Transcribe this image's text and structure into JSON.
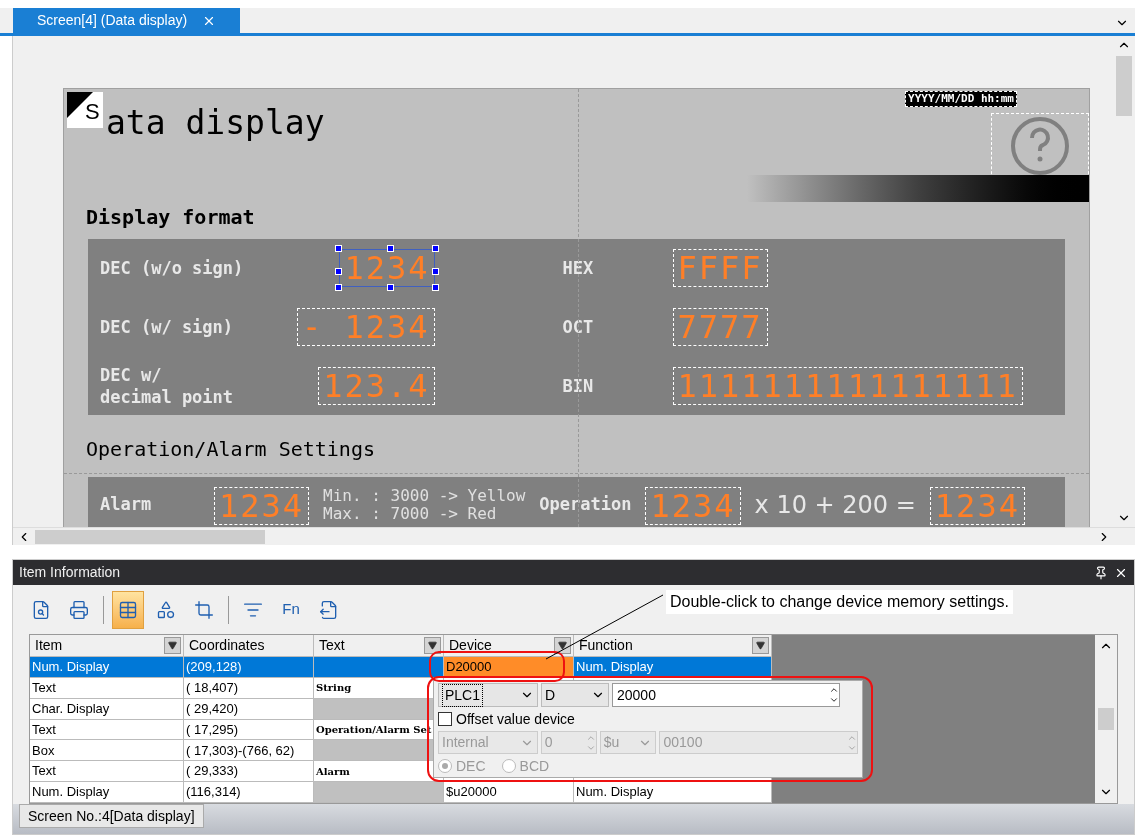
{
  "tabs": [
    {
      "label": "Screen[4] (Data display)",
      "selected": true
    }
  ],
  "canvas": {
    "title": "ata display",
    "logo_letter": "S",
    "datetime": "YYYY/MM/DD hh:mm",
    "section_1": "Display format",
    "formats_left": [
      {
        "label": "DEC (w/o sign)",
        "value": "1234",
        "selected": true
      },
      {
        "label": "DEC (w/ sign)",
        "value": "- 1234",
        "selected": false
      },
      {
        "label": "DEC w/\ndecimal point",
        "value": "123.4",
        "selected": false
      }
    ],
    "formats_right": [
      {
        "label": "HEX",
        "value": "FFFF",
        "selected": false
      },
      {
        "label": "OCT",
        "value": "7777",
        "selected": false
      },
      {
        "label": "BIN",
        "value": "1111111111111111",
        "selected": false
      }
    ],
    "section_2": "Operation/Alarm Settings",
    "alarm": {
      "label": "Alarm",
      "value": "1234",
      "min": "Min. : 3000 -> Yellow",
      "max": "Max. : 7000 -> Red"
    },
    "operation": {
      "label": "Operation",
      "value": "1234",
      "formula": "x 10 + 200 =",
      "result": "1234"
    }
  },
  "panel": {
    "title": "Item Information",
    "toolbar": [
      {
        "kind": "preview",
        "selected": false
      },
      {
        "kind": "print",
        "selected": false
      },
      {
        "kind": "sep"
      },
      {
        "kind": "table",
        "selected": true
      },
      {
        "kind": "shapes",
        "selected": false
      },
      {
        "kind": "frame",
        "selected": false
      },
      {
        "kind": "sep"
      },
      {
        "kind": "edit",
        "selected": false
      },
      {
        "kind": "function",
        "label": "Fn",
        "selected": false
      },
      {
        "kind": "export",
        "selected": false
      }
    ],
    "callout": "Double-click to change device memory settings.",
    "columns": [
      {
        "label": "Item",
        "filter": true
      },
      {
        "label": "Coordinates",
        "filter": false
      },
      {
        "label": "Text",
        "filter": true
      },
      {
        "label": "Device",
        "filter": true
      },
      {
        "label": "Function",
        "filter": true
      }
    ],
    "rows": [
      {
        "item": "Num. Display",
        "coordinates": "(209,128)",
        "text": "",
        "text_shaded": false,
        "device": "D20000",
        "function": "Num. Display",
        "selected": true
      },
      {
        "item": "Text",
        "coordinates": "( 18,407)",
        "text": "String",
        "text_shaded": false,
        "selected": false
      },
      {
        "item": "Char. Display",
        "coordinates": "( 29,420)",
        "text": "",
        "text_shaded": true,
        "selected": false
      },
      {
        "item": "Text",
        "coordinates": "( 17,295)",
        "text": "Operation/Alarm Set",
        "text_shaded": false,
        "selected": false
      },
      {
        "item": "Box",
        "coordinates": "( 17,303)-(766, 62)",
        "text": "",
        "text_shaded": true,
        "selected": false
      },
      {
        "item": "Text",
        "coordinates": "( 29,333)",
        "text": "Alarm",
        "text_shaded": false,
        "selected": false
      },
      {
        "item": "Num. Display",
        "coordinates": "(116,314)",
        "text": "",
        "text_shaded": true,
        "device": "$u20000",
        "function": "Num. Display",
        "selected": false
      }
    ],
    "popup": {
      "plc": "PLC1",
      "device": "D",
      "address": "20000",
      "offset": {
        "label": "Offset value device",
        "checked": false
      },
      "offset_source": "Internal",
      "offset_number": "0",
      "offset_type": "$u",
      "offset_value": "00100",
      "formats": [
        {
          "label": "DEC",
          "selected": true
        },
        {
          "label": "BCD",
          "selected": false
        }
      ]
    }
  },
  "status_tab": "Screen No.:4[Data display]"
}
